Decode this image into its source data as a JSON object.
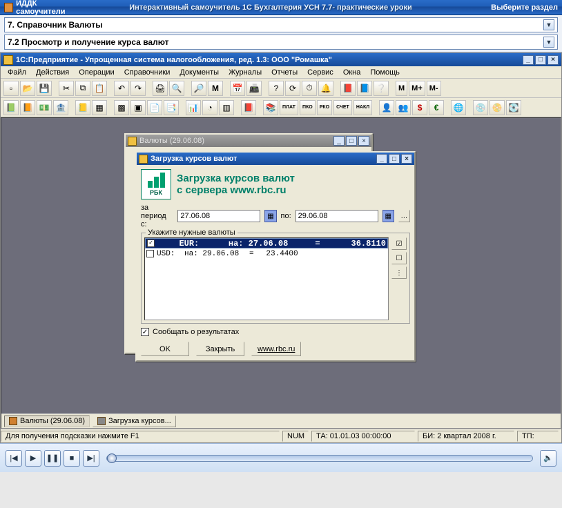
{
  "outer": {
    "brand": "ИДДК самоучители",
    "center": "Интерактивный самоучитель 1С  Бухгалтерия УСН  7.7- практические уроки",
    "right": "Выберите раздел",
    "select1": "7. Справочник Валюты",
    "select2": "7.2 Просмотр и получение курса валют"
  },
  "app": {
    "title": "1С:Предприятие - Упрощенная система налогообложения, ред. 1.3: ООО \"Ромашка\"",
    "menu": [
      "Файл",
      "Действия",
      "Операции",
      "Справочники",
      "Документы",
      "Журналы",
      "Отчеты",
      "Сервис",
      "Окна",
      "Помощь"
    ],
    "m_labels": {
      "m": "M",
      "mp": "M+",
      "mm": "M-"
    }
  },
  "child_back": {
    "title": "Валюты (29.06.08)"
  },
  "dlg": {
    "title": "Загрузка курсов валют",
    "header1": "Загрузка курсов валют",
    "header2": "с сервера www.rbc.ru",
    "rbc": "РБК",
    "period_label": "за период с:",
    "date_from": "27.06.08",
    "to_label": "по:",
    "date_to": "29.06.08",
    "group_legend": "Укажите нужные валюты",
    "rows": [
      {
        "checked": true,
        "code": "EUR:",
        "date": "на: 27.06.08",
        "eq": "=",
        "rate": "36.8110"
      },
      {
        "checked": false,
        "code": "USD:",
        "date": "на: 29.06.08",
        "eq": "=",
        "rate": "23.4400"
      }
    ],
    "notify": "Сообщать о результатах",
    "ok": "OK",
    "close": "Закрыть",
    "link": "www.rbc.ru",
    "notify_checked": "✓"
  },
  "tasks": [
    {
      "label": "Валюты (29.06.08)",
      "icon": "cur"
    },
    {
      "label": "Загрузка курсов...",
      "icon": "sigma",
      "active": true
    }
  ],
  "status": {
    "hint": "Для получения подсказки нажмите F1",
    "num": "NUM",
    "ta": "ТА: 01.01.03  00:00:00",
    "bi": "БИ: 2 квартал 2008 г.",
    "tp": "ТП:"
  },
  "winbtns": {
    "min": "_",
    "max": "□",
    "close": "×"
  }
}
